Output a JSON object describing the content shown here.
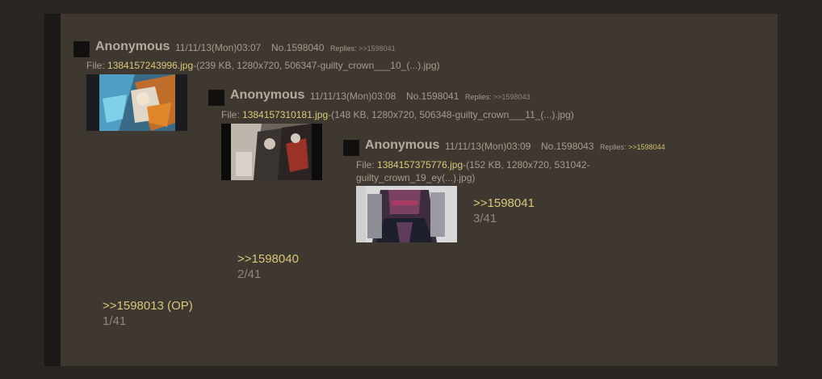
{
  "posts": [
    {
      "name": "Anonymous",
      "datetime": "11/11/13(Mon)03:07",
      "number": "No.1598040",
      "replies_label": "Replies:",
      "replies_ref": ">>1598041",
      "file_label": "File:",
      "file_name": "1384157243996.jpg",
      "file_info": "-(239 KB, 1280x720, 506347-guilty_crown___10_(...).jpg)",
      "backlink": ">>1598013 (OP)",
      "counter": "1/41",
      "thumb_icon": "anime-thumbnail-blue-orange"
    },
    {
      "name": "Anonymous",
      "datetime": "11/11/13(Mon)03:08",
      "number": "No.1598041",
      "replies_label": "Replies:",
      "replies_ref": ">>1598043",
      "file_label": "File:",
      "file_name": "1384157310181.jpg",
      "file_info": "-(148 KB, 1280x720, 506348-guilty_crown___11_(...).jpg)",
      "backlink": ">>1598040",
      "counter": "2/41",
      "thumb_icon": "anime-thumbnail-group-scene"
    },
    {
      "name": "Anonymous",
      "datetime": "11/11/13(Mon)03:09",
      "number": "No.1598043",
      "replies_label": "Replies:",
      "replies_ref": ">>1598044",
      "file_label": "File:",
      "file_name": "1384157375776.jpg",
      "file_info_line1": "-(152 KB, 1280x720, 531042-",
      "file_info_line2": "guilty_crown_19_ey(...).jpg)",
      "backlink": ">>1598041",
      "counter": "3/41",
      "thumb_icon": "anime-thumbnail-character-closeup"
    }
  ],
  "colors": {
    "background": "#2a2622",
    "panel": "#3f3830",
    "link": "#d6c77c",
    "text": "#a59c90"
  }
}
